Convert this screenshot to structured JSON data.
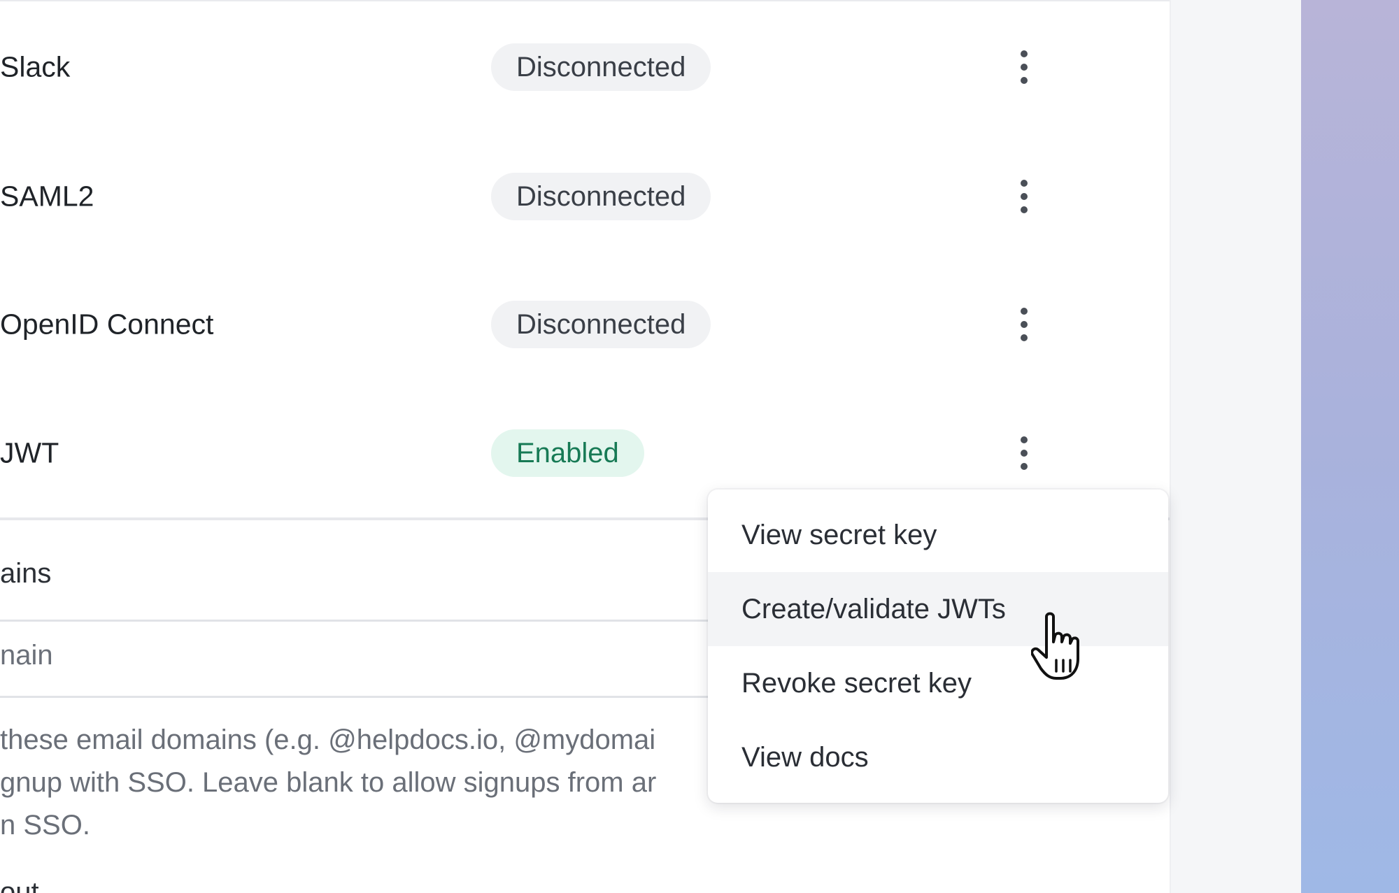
{
  "sso_providers": [
    {
      "name": "Slack",
      "status": "Disconnected",
      "status_kind": "off"
    },
    {
      "name": "SAML2",
      "status": "Disconnected",
      "status_kind": "off"
    },
    {
      "name": "OpenID Connect",
      "status": "Disconnected",
      "status_kind": "off"
    },
    {
      "name": "JWT",
      "status": "Enabled",
      "status_kind": "on"
    }
  ],
  "domains": {
    "label": "ains",
    "input_placeholder": "nain",
    "help_lines": [
      "these email domains (e.g. @helpdocs.io, @mydomai",
      "gnup with SSO. Leave blank to allow signups from ar",
      "n SSO."
    ],
    "next_label": "out"
  },
  "context_menu": {
    "items": [
      {
        "label": "View secret key"
      },
      {
        "label": "Create/validate JWTs",
        "hover": true
      },
      {
        "label": "Revoke secret key"
      },
      {
        "label": "View docs"
      }
    ]
  },
  "colors": {
    "enabled_bg": "#e3f6ee",
    "enabled_text": "#177a55",
    "disconnected_bg": "#f1f2f4",
    "accent_gradient": [
      "#b8b4d8",
      "#9fb8e6"
    ]
  },
  "icons": {
    "row_menu": "kebab-vertical-icon",
    "pointer": "hand-pointer-cursor-icon"
  }
}
